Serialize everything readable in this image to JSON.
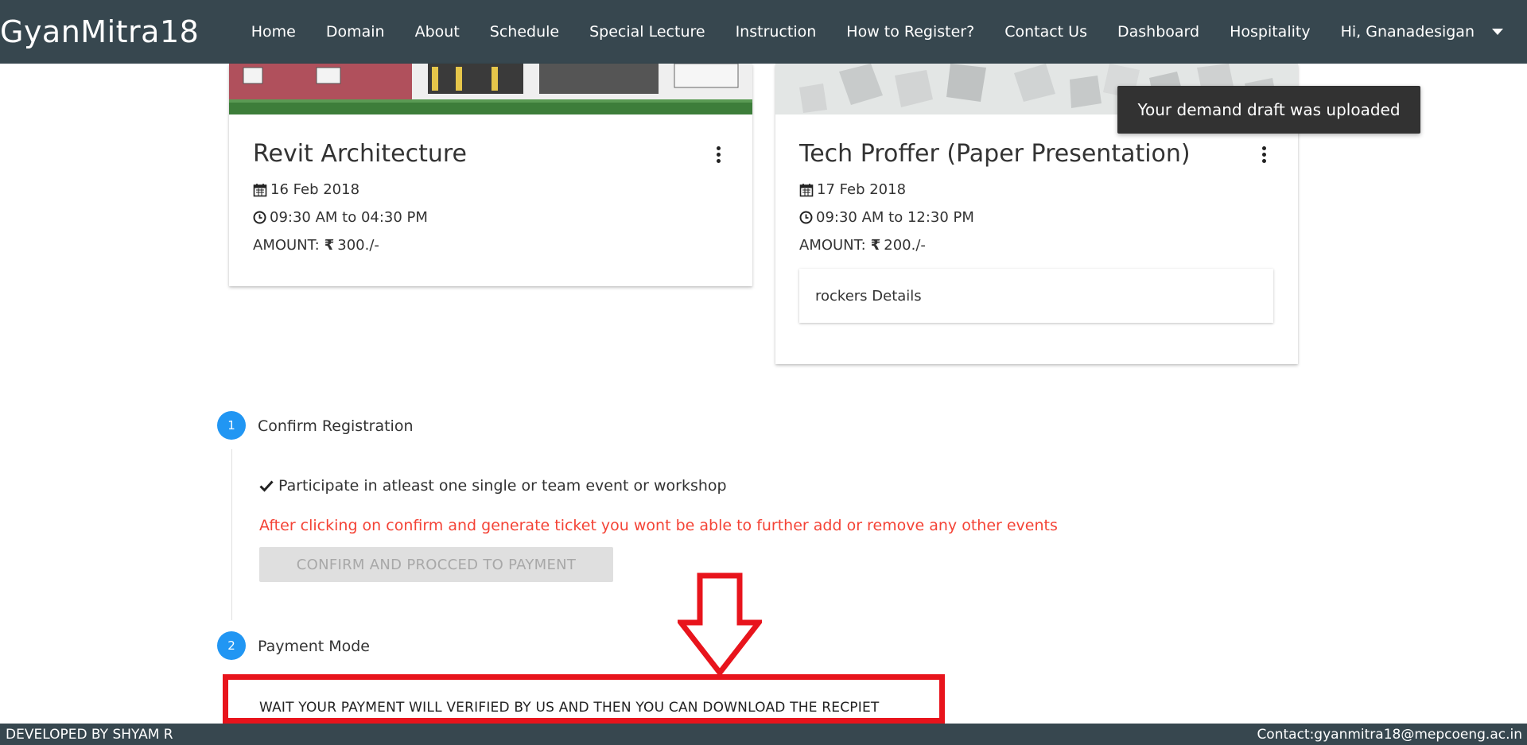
{
  "nav": {
    "brand": "GyanMitra18",
    "links": [
      "Home",
      "Domain",
      "About",
      "Schedule",
      "Special Lecture",
      "Instruction",
      "How to Register?",
      "Contact Us",
      "Dashboard",
      "Hospitality"
    ],
    "user": "Hi, Gnanadesigan"
  },
  "toast": "Your demand draft was uploaded",
  "cards": [
    {
      "title": "Revit Architecture",
      "date": "16 Feb 2018",
      "time": "09:30 AM to 04:30 PM",
      "amount_label": "AMOUNT:",
      "amount": "300./-"
    },
    {
      "title": "Tech Proffer (Paper Presentation)",
      "date": "17 Feb 2018",
      "time": "09:30 AM to 12:30 PM",
      "amount_label": "AMOUNT:",
      "amount": "200./-",
      "details": "rockers Details"
    }
  ],
  "steps": [
    {
      "number": "1",
      "label": "Confirm Registration"
    },
    {
      "number": "2",
      "label": "Payment Mode"
    }
  ],
  "confirm": {
    "check_text": "Participate in atleast one single or team event or workshop",
    "warning": "After clicking on confirm and generate ticket you wont be able to further add or remove any other events",
    "button": "CONFIRM AND PROCCED TO PAYMENT"
  },
  "payment": {
    "message": "WAIT YOUR PAYMENT WILL VERIFIED BY US AND THEN YOU CAN DOWNLOAD THE RECPIET"
  },
  "footer": {
    "left": "DEVELOPED BY SHYAM R",
    "right": "Contact:gyanmitra18@mepcoeng.ac.in"
  },
  "colors": {
    "navbar": "#37474f",
    "step": "#2196f3",
    "warning": "#f44336",
    "annotation": "#e8141c"
  },
  "icons": [
    "calendar-icon",
    "clock-icon",
    "rupee-icon",
    "more-vert-icon",
    "check-icon",
    "arrow-down-icon"
  ]
}
